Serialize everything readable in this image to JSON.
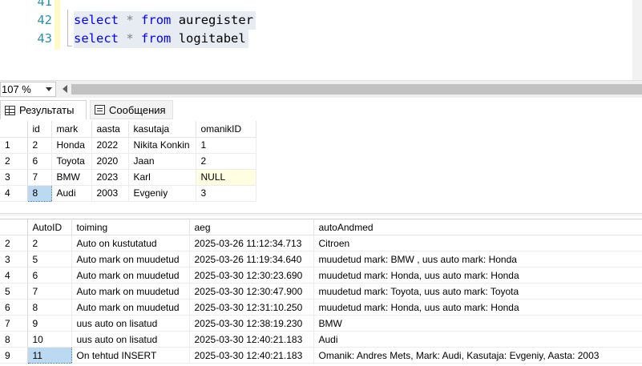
{
  "editor": {
    "lines": [
      {
        "number": "41",
        "code": null
      },
      {
        "number": "42",
        "keyword1": "select",
        "star": "*",
        "keyword2": "from",
        "table": "auregister"
      },
      {
        "number": "43",
        "keyword1": "select",
        "star": "*",
        "keyword2": "from",
        "table": "logitabel"
      }
    ]
  },
  "zoom": {
    "value": "107 %"
  },
  "tabs": [
    {
      "label": "Результаты",
      "icon": "grid-icon",
      "active": true
    },
    {
      "label": "Сообщения",
      "icon": "message-icon",
      "active": false
    }
  ],
  "result1": {
    "columns": [
      "id",
      "mark",
      "aasta",
      "kasutaja",
      "omanikID"
    ],
    "rows": [
      {
        "rn": "1",
        "cells": [
          "2",
          "Honda",
          "2022",
          "Nikita Konkin",
          "1"
        ]
      },
      {
        "rn": "2",
        "cells": [
          "6",
          "Toyota",
          "2020",
          "Jaan",
          "2"
        ]
      },
      {
        "rn": "3",
        "cells": [
          "7",
          "BMW",
          "2023",
          "Karl",
          "NULL"
        ]
      },
      {
        "rn": "4",
        "cells": [
          "8",
          "Audi",
          "2003",
          "Evgeniy",
          "3"
        ]
      }
    ]
  },
  "result2": {
    "columns": [
      "AutoID",
      "toiming",
      "aeg",
      "autoAndmed"
    ],
    "rows": [
      {
        "rn": "2",
        "cells": [
          "2",
          "Auto on kustutatud",
          "2025-03-26 11:12:34.713",
          "Citroen"
        ]
      },
      {
        "rn": "3",
        "cells": [
          "5",
          "Auto mark on muudetud",
          "2025-03-26 11:19:34.640",
          "muudetud mark: BMW , uus auto mark: Honda"
        ]
      },
      {
        "rn": "4",
        "cells": [
          "6",
          "Auto mark on muudetud",
          "2025-03-30 12:30:23.690",
          "muudetud mark: Honda, uus auto mark: Honda"
        ]
      },
      {
        "rn": "5",
        "cells": [
          "7",
          "Auto mark on muudetud",
          "2025-03-30 12:30:47.900",
          "muudetud mark: Toyota, uus auto mark: Toyota"
        ]
      },
      {
        "rn": "6",
        "cells": [
          "8",
          "Auto mark on muudetud",
          "2025-03-30 12:31:10.250",
          "muudetud mark: Honda, uus auto mark: Honda"
        ]
      },
      {
        "rn": "7",
        "cells": [
          "9",
          "uus auto on lisatud",
          "2025-03-30 12:38:19.230",
          "BMW"
        ]
      },
      {
        "rn": "8",
        "cells": [
          "10",
          "uus auto on lisatud",
          "2025-03-30 12:40:21.183",
          "Audi"
        ]
      },
      {
        "rn": "9",
        "cells": [
          "11",
          "On tehtud INSERT",
          "2025-03-30 12:40:21.183",
          "Omanik: Andres Mets, Mark: Audi, Kasutaja: Evgeniy, Aasta: 2003"
        ]
      }
    ]
  },
  "colors": {
    "keyword": "#0000ff",
    "line_number": "#2b91af",
    "null_cell": "#fffee0",
    "selected_cell": "#bcd9f2"
  }
}
